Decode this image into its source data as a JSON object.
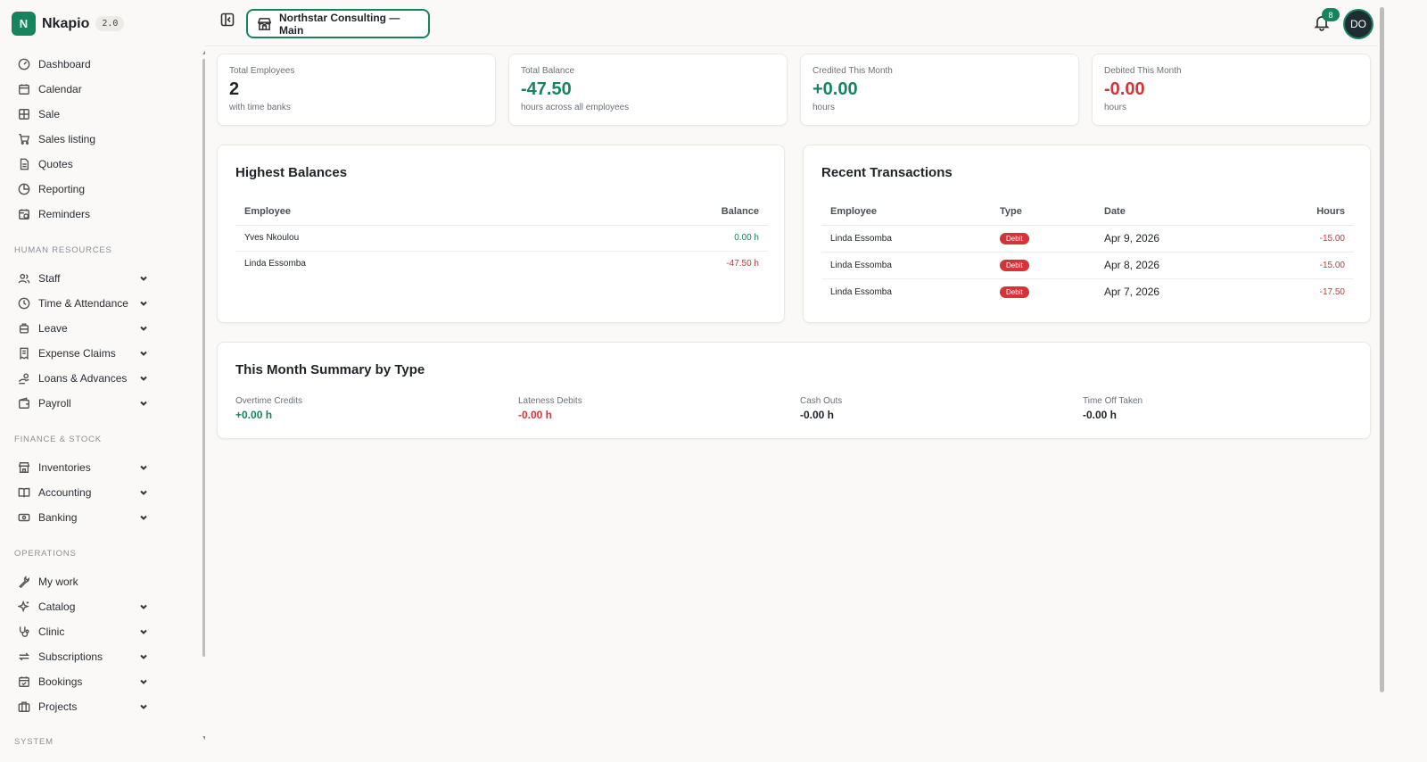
{
  "brand": {
    "logo_letter": "N",
    "name": "Nkapio",
    "version": "2.0"
  },
  "sidebar": {
    "top_items": [
      {
        "label": "Dashboard"
      },
      {
        "label": "Calendar"
      },
      {
        "label": "Sale"
      },
      {
        "label": "Sales listing"
      },
      {
        "label": "Quotes"
      },
      {
        "label": "Reporting"
      },
      {
        "label": "Reminders"
      }
    ],
    "sections": [
      {
        "title": "HUMAN RESOURCES",
        "items": [
          {
            "label": "Staff"
          },
          {
            "label": "Time & Attendance"
          },
          {
            "label": "Leave"
          },
          {
            "label": "Expense Claims"
          },
          {
            "label": "Loans & Advances"
          },
          {
            "label": "Payroll"
          }
        ]
      },
      {
        "title": "FINANCE & STOCK",
        "items": [
          {
            "label": "Inventories"
          },
          {
            "label": "Accounting"
          },
          {
            "label": "Banking"
          }
        ]
      },
      {
        "title": "OPERATIONS",
        "items": [
          {
            "label": "My work"
          },
          {
            "label": "Catalog"
          },
          {
            "label": "Clinic"
          },
          {
            "label": "Subscriptions"
          },
          {
            "label": "Bookings"
          },
          {
            "label": "Projects"
          }
        ]
      },
      {
        "title": "SYSTEM",
        "items": []
      }
    ]
  },
  "topbar": {
    "store_label": "Northstar Consulting — Main",
    "notification_count": "8",
    "avatar_initials": "DO"
  },
  "stats": [
    {
      "label": "Total Employees",
      "value": "2",
      "sub": "with time banks"
    },
    {
      "label": "Total Balance",
      "value": "-47.50",
      "sub": "hours across all employees"
    },
    {
      "label": "Credited This Month",
      "value": "+0.00",
      "sub": "hours"
    },
    {
      "label": "Debited This Month",
      "value": "-0.00",
      "sub": "hours"
    }
  ],
  "highest_balances": {
    "title": "Highest Balances",
    "columns": {
      "employee": "Employee",
      "balance": "Balance"
    },
    "rows": [
      {
        "employee": "Yves Nkoulou",
        "balance": "0.00 h"
      },
      {
        "employee": "Linda Essomba",
        "balance": "-47.50 h"
      }
    ]
  },
  "recent_transactions": {
    "title": "Recent Transactions",
    "columns": {
      "employee": "Employee",
      "type": "Type",
      "date": "Date",
      "hours": "Hours"
    },
    "rows": [
      {
        "employee": "Linda Essomba",
        "type": "Debit",
        "date": "Apr 9, 2026",
        "hours": "-15.00"
      },
      {
        "employee": "Linda Essomba",
        "type": "Debit",
        "date": "Apr 8, 2026",
        "hours": "-15.00"
      },
      {
        "employee": "Linda Essomba",
        "type": "Debit",
        "date": "Apr 7, 2026",
        "hours": "-17.50"
      }
    ]
  },
  "summary": {
    "title": "This Month Summary by Type",
    "items": [
      {
        "label": "Overtime Credits",
        "value": "+0.00 h"
      },
      {
        "label": "Lateness Debits",
        "value": "-0.00 h"
      },
      {
        "label": "Cash Outs",
        "value": "-0.00 h"
      },
      {
        "label": "Time Off Taken",
        "value": "-0.00 h"
      }
    ]
  },
  "colors": {
    "accent": "#16855f",
    "danger": "#d3343a",
    "background": "#faf9f7"
  }
}
